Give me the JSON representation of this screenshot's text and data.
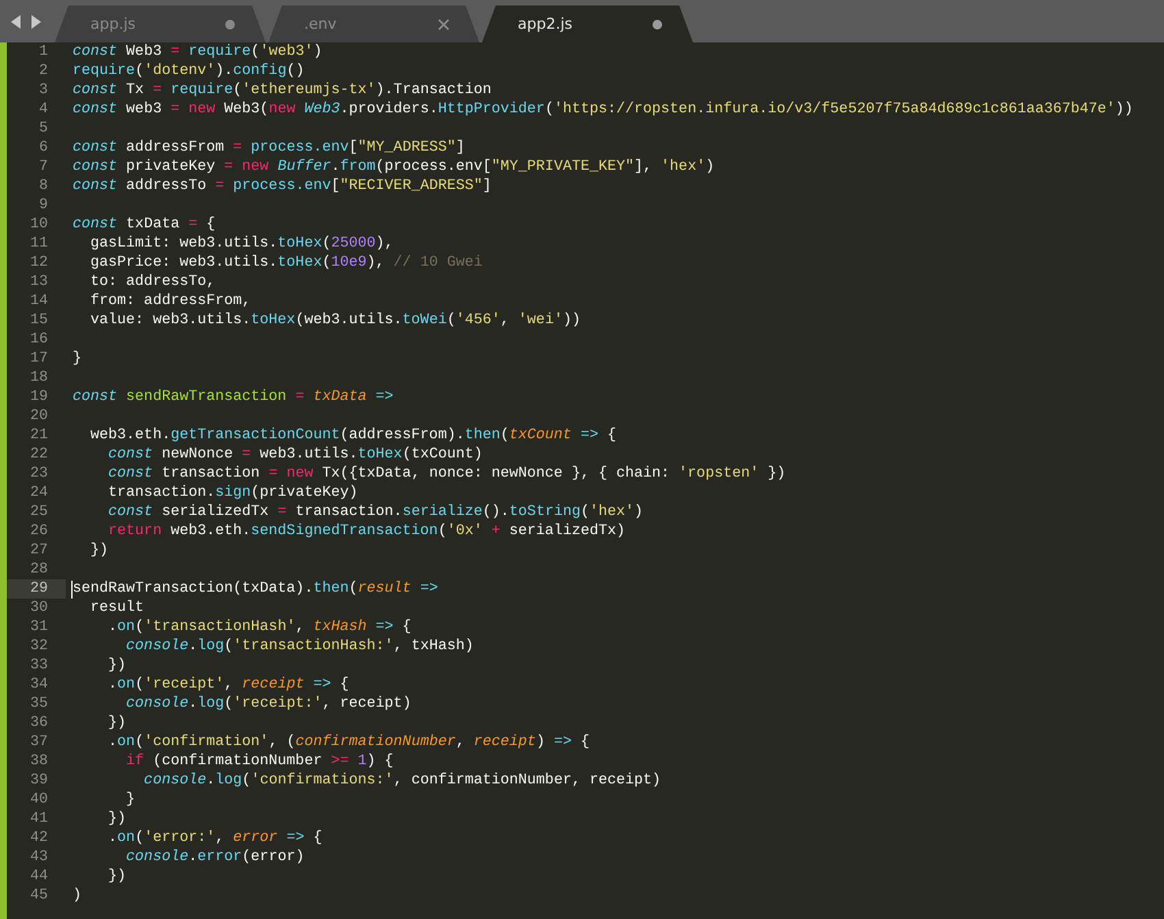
{
  "tabs": [
    {
      "label": "app.js",
      "selected": false,
      "dirty": true
    },
    {
      "label": ".env",
      "selected": false,
      "dirty": false
    },
    {
      "label": "app2.js",
      "selected": true,
      "dirty": true
    }
  ],
  "lines": [
    {
      "number": "1",
      "tokens": [
        {
          "kind": "storage",
          "text": "const"
        },
        {
          "kind": "plain",
          "text": " Web3 "
        },
        {
          "kind": "op",
          "text": "= "
        },
        {
          "kind": "func",
          "text": "require"
        },
        {
          "kind": "plain",
          "text": "("
        },
        {
          "kind": "string",
          "text": "'web3'"
        },
        {
          "kind": "plain",
          "text": ")"
        }
      ]
    },
    {
      "number": "2",
      "tokens": [
        {
          "kind": "func",
          "text": "require"
        },
        {
          "kind": "plain",
          "text": "("
        },
        {
          "kind": "string",
          "text": "'dotenv'"
        },
        {
          "kind": "plain",
          "text": ")."
        },
        {
          "kind": "func",
          "text": "config"
        },
        {
          "kind": "plain",
          "text": "()"
        }
      ]
    },
    {
      "number": "3",
      "tokens": [
        {
          "kind": "storage",
          "text": "const"
        },
        {
          "kind": "plain",
          "text": " Tx "
        },
        {
          "kind": "op",
          "text": "= "
        },
        {
          "kind": "func",
          "text": "require"
        },
        {
          "kind": "plain",
          "text": "("
        },
        {
          "kind": "string",
          "text": "'ethereumjs-tx'"
        },
        {
          "kind": "plain",
          "text": ").Transaction"
        }
      ]
    },
    {
      "number": "4",
      "tokens": [
        {
          "kind": "storage",
          "text": "const"
        },
        {
          "kind": "plain",
          "text": " web3 "
        },
        {
          "kind": "op",
          "text": "= "
        },
        {
          "kind": "keyword",
          "text": "new "
        },
        {
          "kind": "plain",
          "text": "Web3("
        },
        {
          "kind": "keyword",
          "text": "new "
        },
        {
          "kind": "class",
          "text": "Web3"
        },
        {
          "kind": "plain",
          "text": ".providers."
        },
        {
          "kind": "func",
          "text": "HttpProvider"
        },
        {
          "kind": "plain",
          "text": "("
        },
        {
          "kind": "string",
          "text": "'https://ropsten.infura.io/v3/f5e5207f75a84d689c1c861aa367b47e'"
        },
        {
          "kind": "plain",
          "text": "))"
        }
      ]
    },
    {
      "number": "5"
    },
    {
      "number": "6",
      "tokens": [
        {
          "kind": "storage",
          "text": "const"
        },
        {
          "kind": "plain",
          "text": " addressFrom "
        },
        {
          "kind": "op",
          "text": "= "
        },
        {
          "kind": "func",
          "text": "process.env"
        },
        {
          "kind": "plain",
          "text": "["
        },
        {
          "kind": "string",
          "text": "\"MY_ADRESS\""
        },
        {
          "kind": "plain",
          "text": "]"
        }
      ]
    },
    {
      "number": "7",
      "tokens": [
        {
          "kind": "storage",
          "text": "const"
        },
        {
          "kind": "plain",
          "text": " privateKey "
        },
        {
          "kind": "op",
          "text": "= "
        },
        {
          "kind": "keyword",
          "text": "new "
        },
        {
          "kind": "class",
          "text": "Buffer"
        },
        {
          "kind": "plain",
          "text": "."
        },
        {
          "kind": "func",
          "text": "from"
        },
        {
          "kind": "plain",
          "text": "(process.env["
        },
        {
          "kind": "string",
          "text": "\"MY_PRIVATE_KEY\""
        },
        {
          "kind": "plain",
          "text": "], "
        },
        {
          "kind": "string",
          "text": "'hex'"
        },
        {
          "kind": "plain",
          "text": ")"
        }
      ]
    },
    {
      "number": "8",
      "tokens": [
        {
          "kind": "storage",
          "text": "const"
        },
        {
          "kind": "plain",
          "text": " addressTo "
        },
        {
          "kind": "op",
          "text": "= "
        },
        {
          "kind": "func",
          "text": "process.env"
        },
        {
          "kind": "plain",
          "text": "["
        },
        {
          "kind": "string",
          "text": "\"RECIVER_ADRESS\""
        },
        {
          "kind": "plain",
          "text": "]"
        }
      ]
    },
    {
      "number": "9"
    },
    {
      "number": "10",
      "tokens": [
        {
          "kind": "storage",
          "text": "const"
        },
        {
          "kind": "plain",
          "text": " txData "
        },
        {
          "kind": "op",
          "text": "="
        },
        {
          "kind": "plain",
          "text": " {"
        }
      ]
    },
    {
      "number": "11",
      "tokens": [
        {
          "kind": "plain",
          "text": "  gasLimit: web3.utils."
        },
        {
          "kind": "func",
          "text": "toHex"
        },
        {
          "kind": "plain",
          "text": "("
        },
        {
          "kind": "number",
          "text": "25000"
        },
        {
          "kind": "plain",
          "text": "),"
        }
      ]
    },
    {
      "number": "12",
      "tokens": [
        {
          "kind": "plain",
          "text": "  gasPrice: web3.utils."
        },
        {
          "kind": "func",
          "text": "toHex"
        },
        {
          "kind": "plain",
          "text": "("
        },
        {
          "kind": "number",
          "text": "10e9"
        },
        {
          "kind": "plain",
          "text": "), "
        },
        {
          "kind": "comment",
          "text": "// 10 Gwei"
        }
      ]
    },
    {
      "number": "13",
      "tokens": [
        {
          "kind": "plain",
          "text": "  to: addressTo,"
        }
      ]
    },
    {
      "number": "14",
      "tokens": [
        {
          "kind": "plain",
          "text": "  from: addressFrom,"
        }
      ]
    },
    {
      "number": "15",
      "tokens": [
        {
          "kind": "plain",
          "text": "  value: web3.utils."
        },
        {
          "kind": "func",
          "text": "toHex"
        },
        {
          "kind": "plain",
          "text": "(web3.utils."
        },
        {
          "kind": "func",
          "text": "toWei"
        },
        {
          "kind": "plain",
          "text": "("
        },
        {
          "kind": "string",
          "text": "'456'"
        },
        {
          "kind": "plain",
          "text": ", "
        },
        {
          "kind": "string",
          "text": "'wei'"
        },
        {
          "kind": "plain",
          "text": "))"
        }
      ]
    },
    {
      "number": "16"
    },
    {
      "number": "17",
      "tokens": [
        {
          "kind": "plain",
          "text": "}"
        }
      ]
    },
    {
      "number": "18"
    },
    {
      "number": "19",
      "tokens": [
        {
          "kind": "storage",
          "text": "const "
        },
        {
          "kind": "name",
          "text": "sendRawTransaction "
        },
        {
          "kind": "op",
          "text": "= "
        },
        {
          "kind": "param",
          "text": "txData "
        },
        {
          "kind": "arrow",
          "text": "=>"
        }
      ]
    },
    {
      "number": "20"
    },
    {
      "number": "21",
      "tokens": [
        {
          "kind": "plain",
          "text": "  web3.eth."
        },
        {
          "kind": "func",
          "text": "getTransactionCount"
        },
        {
          "kind": "plain",
          "text": "(addressFrom)."
        },
        {
          "kind": "func",
          "text": "then"
        },
        {
          "kind": "plain",
          "text": "("
        },
        {
          "kind": "param",
          "text": "txCount "
        },
        {
          "kind": "arrow",
          "text": "=>"
        },
        {
          "kind": "plain",
          "text": " {"
        }
      ]
    },
    {
      "number": "22",
      "tokens": [
        {
          "kind": "storage",
          "text": "    const"
        },
        {
          "kind": "plain",
          "text": " newNonce "
        },
        {
          "kind": "op",
          "text": "="
        },
        {
          "kind": "plain",
          "text": " web3.utils."
        },
        {
          "kind": "func",
          "text": "toHex"
        },
        {
          "kind": "plain",
          "text": "(txCount)"
        }
      ]
    },
    {
      "number": "23",
      "tokens": [
        {
          "kind": "storage",
          "text": "    const"
        },
        {
          "kind": "plain",
          "text": " transaction "
        },
        {
          "kind": "op",
          "text": "= "
        },
        {
          "kind": "keyword",
          "text": "new"
        },
        {
          "kind": "plain",
          "text": " Tx({txData, nonce: newNonce }, { chain: "
        },
        {
          "kind": "string",
          "text": "'ropsten'"
        },
        {
          "kind": "plain",
          "text": " })"
        }
      ]
    },
    {
      "number": "24",
      "tokens": [
        {
          "kind": "plain",
          "text": "    transaction."
        },
        {
          "kind": "func",
          "text": "sign"
        },
        {
          "kind": "plain",
          "text": "(privateKey)"
        }
      ]
    },
    {
      "number": "25",
      "tokens": [
        {
          "kind": "storage",
          "text": "    const"
        },
        {
          "kind": "plain",
          "text": " serializedTx "
        },
        {
          "kind": "op",
          "text": "="
        },
        {
          "kind": "plain",
          "text": " transaction."
        },
        {
          "kind": "func",
          "text": "serialize"
        },
        {
          "kind": "plain",
          "text": "()."
        },
        {
          "kind": "func",
          "text": "toString"
        },
        {
          "kind": "plain",
          "text": "("
        },
        {
          "kind": "string",
          "text": "'hex'"
        },
        {
          "kind": "plain",
          "text": ")"
        }
      ]
    },
    {
      "number": "26",
      "tokens": [
        {
          "kind": "keyword",
          "text": "    return"
        },
        {
          "kind": "plain",
          "text": " web3.eth."
        },
        {
          "kind": "func",
          "text": "sendSignedTransaction"
        },
        {
          "kind": "plain",
          "text": "("
        },
        {
          "kind": "string",
          "text": "'0x' "
        },
        {
          "kind": "op",
          "text": "+"
        },
        {
          "kind": "plain",
          "text": " serializedTx)"
        }
      ]
    },
    {
      "number": "27",
      "tokens": [
        {
          "kind": "plain",
          "text": "  })"
        }
      ]
    },
    {
      "number": "28"
    },
    {
      "number": "29",
      "current": true,
      "tokens": [
        {
          "kind": "plain",
          "text": "sendRawTransaction(txData)."
        },
        {
          "kind": "func",
          "text": "then"
        },
        {
          "kind": "plain",
          "text": "("
        },
        {
          "kind": "param",
          "text": "result "
        },
        {
          "kind": "arrow",
          "text": "=>"
        }
      ]
    },
    {
      "number": "30",
      "tokens": [
        {
          "kind": "plain",
          "text": "  result"
        }
      ]
    },
    {
      "number": "31",
      "tokens": [
        {
          "kind": "plain",
          "text": "    ."
        },
        {
          "kind": "func",
          "text": "on"
        },
        {
          "kind": "plain",
          "text": "("
        },
        {
          "kind": "string",
          "text": "'transactionHash'"
        },
        {
          "kind": "plain",
          "text": ", "
        },
        {
          "kind": "param",
          "text": "txHash "
        },
        {
          "kind": "arrow",
          "text": "=>"
        },
        {
          "kind": "plain",
          "text": " {"
        }
      ]
    },
    {
      "number": "32",
      "tokens": [
        {
          "kind": "storage",
          "text": "      console"
        },
        {
          "kind": "plain",
          "text": "."
        },
        {
          "kind": "func",
          "text": "log"
        },
        {
          "kind": "plain",
          "text": "("
        },
        {
          "kind": "string",
          "text": "'transactionHash:'"
        },
        {
          "kind": "plain",
          "text": ", txHash)"
        }
      ]
    },
    {
      "number": "33",
      "tokens": [
        {
          "kind": "plain",
          "text": "    })"
        }
      ]
    },
    {
      "number": "34",
      "tokens": [
        {
          "kind": "plain",
          "text": "    ."
        },
        {
          "kind": "func",
          "text": "on"
        },
        {
          "kind": "plain",
          "text": "("
        },
        {
          "kind": "string",
          "text": "'receipt'"
        },
        {
          "kind": "plain",
          "text": ", "
        },
        {
          "kind": "param",
          "text": "receipt "
        },
        {
          "kind": "arrow",
          "text": "=>"
        },
        {
          "kind": "plain",
          "text": " {"
        }
      ]
    },
    {
      "number": "35",
      "tokens": [
        {
          "kind": "storage",
          "text": "      console"
        },
        {
          "kind": "plain",
          "text": "."
        },
        {
          "kind": "func",
          "text": "log"
        },
        {
          "kind": "plain",
          "text": "("
        },
        {
          "kind": "string",
          "text": "'receipt:'"
        },
        {
          "kind": "plain",
          "text": ", receipt)"
        }
      ]
    },
    {
      "number": "36",
      "tokens": [
        {
          "kind": "plain",
          "text": "    })"
        }
      ]
    },
    {
      "number": "37",
      "tokens": [
        {
          "kind": "plain",
          "text": "    ."
        },
        {
          "kind": "func",
          "text": "on"
        },
        {
          "kind": "plain",
          "text": "("
        },
        {
          "kind": "string",
          "text": "'confirmation'"
        },
        {
          "kind": "plain",
          "text": ", ("
        },
        {
          "kind": "param",
          "text": "confirmationNumber"
        },
        {
          "kind": "plain",
          "text": ", "
        },
        {
          "kind": "param",
          "text": "receipt"
        },
        {
          "kind": "plain",
          "text": ") "
        },
        {
          "kind": "arrow",
          "text": "=>"
        },
        {
          "kind": "plain",
          "text": " {"
        }
      ]
    },
    {
      "number": "38",
      "tokens": [
        {
          "kind": "keyword",
          "text": "      if"
        },
        {
          "kind": "plain",
          "text": " (confirmationNumber "
        },
        {
          "kind": "op",
          "text": ">= "
        },
        {
          "kind": "number",
          "text": "1"
        },
        {
          "kind": "plain",
          "text": ") {"
        }
      ]
    },
    {
      "number": "39",
      "tokens": [
        {
          "kind": "storage",
          "text": "        console"
        },
        {
          "kind": "plain",
          "text": "."
        },
        {
          "kind": "func",
          "text": "log"
        },
        {
          "kind": "plain",
          "text": "("
        },
        {
          "kind": "string",
          "text": "'confirmations:'"
        },
        {
          "kind": "plain",
          "text": ", confirmationNumber, receipt)"
        }
      ]
    },
    {
      "number": "40",
      "tokens": [
        {
          "kind": "plain",
          "text": "      }"
        }
      ]
    },
    {
      "number": "41",
      "tokens": [
        {
          "kind": "plain",
          "text": "    })"
        }
      ]
    },
    {
      "number": "42",
      "tokens": [
        {
          "kind": "plain",
          "text": "    ."
        },
        {
          "kind": "func",
          "text": "on"
        },
        {
          "kind": "plain",
          "text": "("
        },
        {
          "kind": "string",
          "text": "'error:'"
        },
        {
          "kind": "plain",
          "text": ", "
        },
        {
          "kind": "param",
          "text": "error "
        },
        {
          "kind": "arrow",
          "text": "=>"
        },
        {
          "kind": "plain",
          "text": " {"
        }
      ]
    },
    {
      "number": "43",
      "tokens": [
        {
          "kind": "storage",
          "text": "      console"
        },
        {
          "kind": "plain",
          "text": "."
        },
        {
          "kind": "func",
          "text": "error"
        },
        {
          "kind": "plain",
          "text": "(error)"
        }
      ]
    },
    {
      "number": "44",
      "tokens": [
        {
          "kind": "plain",
          "text": "    })"
        }
      ]
    },
    {
      "number": "45",
      "tokens": [
        {
          "kind": "plain",
          "text": ")"
        }
      ]
    }
  ]
}
